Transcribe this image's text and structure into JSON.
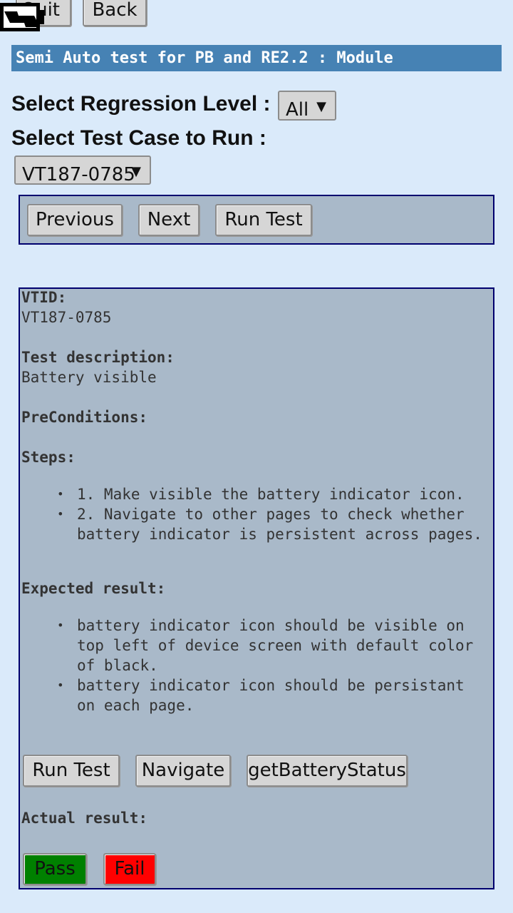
{
  "top": {
    "quit_label": "Quit",
    "back_label": "Back"
  },
  "title": "Semi Auto test for PB and RE2.2 : Module",
  "regression": {
    "label": "Select Regression Level :",
    "selected": "All"
  },
  "testcase": {
    "label": "Select Test Case to Run :",
    "selected": "VT187-0785"
  },
  "nav": {
    "previous": "Previous",
    "next": "Next",
    "run": "Run Test"
  },
  "detail": {
    "vtid_label": "VTID:",
    "vtid_value": "VT187-0785",
    "desc_label": "Test description:",
    "desc_value": "Battery visible",
    "pre_label": "PreConditions:",
    "steps_label": "Steps:",
    "steps": [
      "1. Make visible the battery indicator icon.",
      "2. Navigate to other pages to check whether battery indicator is persistent across pages."
    ],
    "expected_label": "Expected result:",
    "expected": [
      "battery indicator icon should be visible on top left of device screen with default color of black.",
      "battery indicator icon should be persistant on each page."
    ],
    "buttons": {
      "run": "Run Test",
      "navigate": "Navigate",
      "battery": "getBatteryStatus"
    },
    "actual_label": "Actual result:",
    "pass": "Pass",
    "fail": "Fail",
    "colors": {
      "pass": "#008000",
      "fail": "#ff0000"
    }
  },
  "icons": {
    "battery": "battery-charging-icon"
  }
}
